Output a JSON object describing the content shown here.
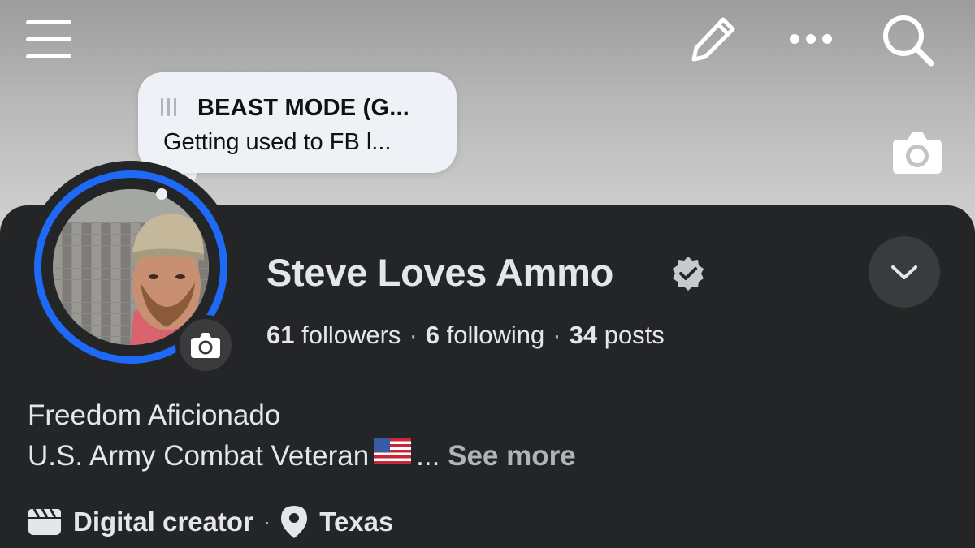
{
  "topbar": {
    "icons": [
      "menu-icon",
      "pencil-icon",
      "more-icon",
      "search-icon"
    ]
  },
  "cover": {
    "camera_icon": "camera-icon"
  },
  "note": {
    "title": "BEAST MODE (G...",
    "text": "Getting used to FB l..."
  },
  "profile": {
    "name": "Steve Loves Ammo",
    "verified": true,
    "followers_count": "61",
    "followers_label": "followers",
    "following_count": "6",
    "following_label": "following",
    "posts_count": "34",
    "posts_label": "posts",
    "separator": "·"
  },
  "bio": {
    "line1": "Freedom Aficionado",
    "line2": "U.S. Army Combat Veteran",
    "ellipsis": "...",
    "see_more": "See more"
  },
  "details": {
    "category": "Digital creator",
    "separator": "·",
    "location": "Texas"
  },
  "colors": {
    "background": "#242526",
    "ring": "#1e6af6",
    "text": "#e4e6eb",
    "muted": "#b0b3b8"
  }
}
